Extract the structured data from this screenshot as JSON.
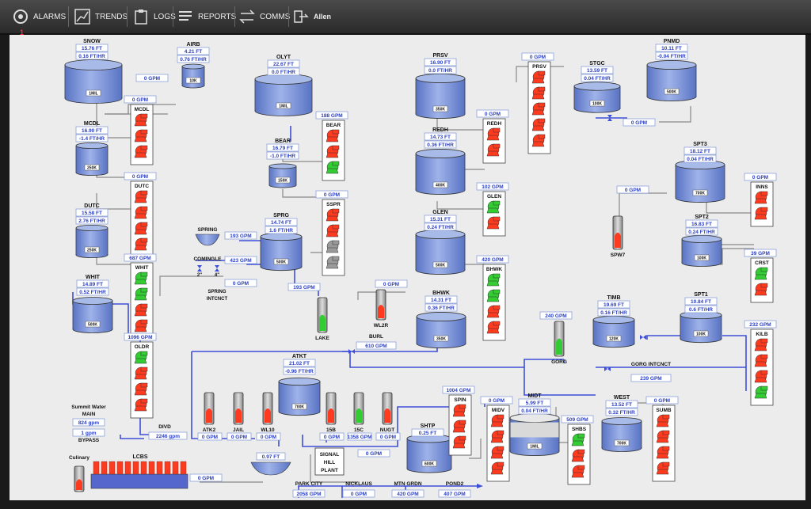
{
  "toolbar": {
    "alarms": "ALARMS",
    "alarm_count": "1",
    "trends": "TRENDS",
    "logs": "LOGS",
    "reports": "REPORTS",
    "comms": "COMMS",
    "user": "Allen"
  },
  "colors": {
    "tank_fill": "#7b93d6",
    "tank_top": "#a8bbe8",
    "pipe": "#3d4fd8",
    "pump_red": "#ff3b1f",
    "pump_green": "#33cc33",
    "pump_gray": "#9a9a9a",
    "value_text": "#2a3fc2"
  },
  "tanks": {
    "snow": {
      "name": "SNOW",
      "level": "15.76 FT",
      "rate": "0.16 FT/HR",
      "cap": "1MIL"
    },
    "airb": {
      "name": "AIRB",
      "level": "4.21 FT",
      "rate": "0.76 FT/HR",
      "cap": "10K"
    },
    "olyt": {
      "name": "OLYT",
      "level": "22.67 FT",
      "rate": "0.0 FT/HR",
      "cap": "1MIL"
    },
    "prsv": {
      "name": "PRSV",
      "level": "16.90 FT",
      "rate": "0.0 FT/HR",
      "cap": "350K"
    },
    "stgc": {
      "name": "STGC",
      "level": "13.59 FT",
      "rate": "0.04 FT/HR",
      "cap": "100K"
    },
    "pnmd": {
      "name": "PNMD",
      "level": "10.11 FT",
      "rate": "-0.04 FT/HR",
      "cap": "500K"
    },
    "mcdl": {
      "name": "MCDL",
      "level": "16.90 FT",
      "rate": "-1.4 FT/HR",
      "cap": "250K"
    },
    "bear": {
      "name": "BEAR",
      "level": "16.79 FT",
      "rate": "-1.0 FT/HR",
      "cap": "150K"
    },
    "redh": {
      "name": "REDH",
      "level": "14.73 FT",
      "rate": "0.36 FT/HR",
      "cap": "400K"
    },
    "spt3": {
      "name": "SPT3",
      "level": "18.12 FT",
      "rate": "0.04 FT/HR",
      "cap": "700K"
    },
    "dutc": {
      "name": "DUTC",
      "level": "15.58 FT",
      "rate": "2.76 FT/HR",
      "cap": "250K"
    },
    "sprg": {
      "name": "SPRG",
      "level": "14.74 FT",
      "rate": "1.6 FT/HR",
      "cap": "500K"
    },
    "glen": {
      "name": "GLEN",
      "level": "15.31 FT",
      "rate": "0.24 FT/HR",
      "cap": "500K"
    },
    "spt2": {
      "name": "SPT2",
      "level": "16.83 FT",
      "rate": "0.24 FT/HR",
      "cap": "100K"
    },
    "whit": {
      "name": "WHIT",
      "level": "14.89 FT",
      "rate": "0.52 FT/HR",
      "cap": "500K"
    },
    "bhwk": {
      "name": "BHWK",
      "level": "14.31 FT",
      "rate": "0.36 FT/HR",
      "cap": "350K"
    },
    "timb": {
      "name": "TIMB",
      "level": "19.69 FT",
      "rate": "0.16 FT/HR",
      "cap": "120K"
    },
    "spt1": {
      "name": "SPT1",
      "level": "10.84 FT",
      "rate": "0.6 FT/HR",
      "cap": "100K"
    },
    "atkt": {
      "name": "ATKT",
      "level": "21.02 FT",
      "rate": "-0.96 FT/HR",
      "cap": "700K"
    },
    "midt": {
      "name": "MIDT",
      "level": "5.99 FT",
      "rate": "0.04 FT/HR",
      "cap": "1MIL"
    },
    "west": {
      "name": "WEST",
      "level": "13.52 FT",
      "rate": "0.32 FT/HR",
      "cap": "700K"
    },
    "shtp": {
      "name": "SHTP",
      "level": "0.25 FT",
      "cap": "600K"
    }
  },
  "pumps": {
    "mcdl": {
      "name": "MCDL",
      "flow": "0 GPM"
    },
    "dutc": {
      "name": "DUTC",
      "flow": "0 GPM"
    },
    "whit": {
      "name": "WHIT",
      "flow": "687 GPM"
    },
    "oldr": {
      "name": "OLDR",
      "flow": "1096 GPM"
    },
    "bear": {
      "name": "BEAR",
      "flow": "188 GPM"
    },
    "sspr": {
      "name": "SSPR",
      "flow": "0 GPM"
    },
    "prsv": {
      "name": "PRSV",
      "flow": "0 GPM"
    },
    "redh": {
      "name": "REDH",
      "flow": "0 GPM"
    },
    "glen": {
      "name": "GLEN",
      "flow": "102 GPM"
    },
    "bhwk": {
      "name": "BHWK",
      "flow": "420 GPM"
    },
    "inns": {
      "name": "INNS",
      "flow": "0 GPM"
    },
    "crst": {
      "name": "CRST",
      "flow": "39 GPM"
    },
    "kilb": {
      "name": "KILB",
      "flow": "232 GPM"
    },
    "spin": {
      "name": "SPIN",
      "flow": "1004 GPM"
    },
    "midv": {
      "name": "MIDV",
      "flow": "0 GPM"
    },
    "shbs": {
      "name": "SHBS",
      "flow": "509 GPM"
    },
    "sumb": {
      "name": "SUMB",
      "flow": "0 GPM"
    }
  },
  "wells": {
    "wl2r": {
      "name": "WL2R"
    },
    "lake": {
      "name": "LAKE"
    },
    "spw7": {
      "name": "SPW7"
    },
    "gorg": {
      "name": "GORG"
    },
    "atk2": {
      "name": "ATK2",
      "flow": "0 GPM"
    },
    "jail": {
      "name": "JAIL",
      "flow": "0 GPM"
    },
    "wl10": {
      "name": "WL10",
      "flow": "0 GPM"
    },
    "w15b": {
      "name": "15B",
      "flow": "0 GPM"
    },
    "w15c": {
      "name": "15C",
      "flow": "1358 GPM"
    },
    "nugt": {
      "name": "NUGT",
      "flow": "0 GPM"
    },
    "culinary": {
      "name": "Culinary"
    }
  },
  "flows": {
    "snow_airb": "0 GPM",
    "spring": "193 GPM",
    "comingle": "423 GPM",
    "spring_intcnct": "0 GPM",
    "lake": "193 GPM",
    "wl2r": "0 GPM",
    "burl": "610 GPM",
    "spw7": "0 GPM",
    "gorg": "240 GPM",
    "gorg_intcnct": "239 GPM",
    "stgc": "0 GPM",
    "summit_main": "824 gpm",
    "summit_bypass": "1 gpm",
    "divd": "2246 gpm",
    "lcbs": "0 GPM",
    "signal_hill": "0 GPM"
  },
  "labels": {
    "spring": "SPRING",
    "comingle": "COMINGLE",
    "two_in": "2\"",
    "four_in": "4\"",
    "spring_intcnct_1": "SPRING",
    "spring_intcnct_2": "INTCNCT",
    "burl": "BURL",
    "gorg_intcnct": "GORG INTCNCT",
    "summit_1": "Summit Water",
    "summit_2": "MAIN",
    "summit_3": "BYPASS",
    "divd": "DIVD",
    "lcbs": "LCBS",
    "lcbs_level": "0.97 FT",
    "signal_1": "SIGNAL",
    "signal_2": "HILL",
    "signal_3": "PLANT"
  },
  "outlets": [
    {
      "name": "PARK CITY",
      "flow": "2058 GPM"
    },
    {
      "name": "NICKLAUS",
      "flow": "0 GPM"
    },
    {
      "name": "MTN GRDN",
      "flow": "420 GPM"
    },
    {
      "name": "POND2",
      "flow": "407 GPM"
    }
  ]
}
